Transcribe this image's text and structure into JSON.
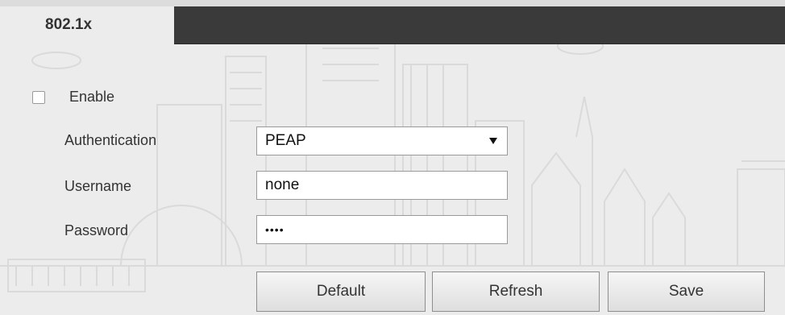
{
  "section": {
    "tab_title": "802.1x"
  },
  "form": {
    "enable_label": "Enable",
    "enable_checked": false,
    "authentication_label": "Authentication",
    "authentication_value": "PEAP",
    "username_label": "Username",
    "username_value": "none",
    "password_label": "Password",
    "password_value": "••••"
  },
  "buttons": {
    "default": "Default",
    "refresh": "Refresh",
    "save": "Save"
  },
  "icons": {
    "dropdown": "caret-down-icon",
    "checkbox": "checkbox-icon"
  },
  "colors": {
    "header_bar": "#3a3a3a",
    "background": "#ececec"
  }
}
